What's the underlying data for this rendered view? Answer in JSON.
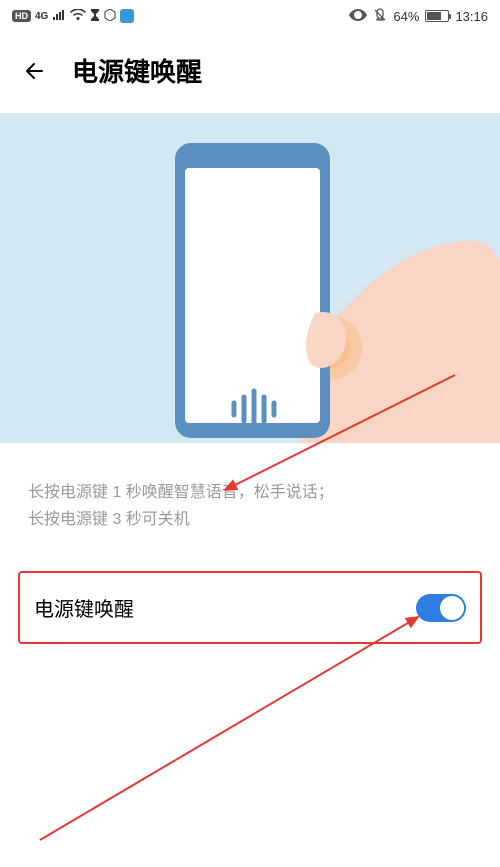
{
  "status": {
    "hd": "HD",
    "net": "4G",
    "battery_text": "64%",
    "time": "13:16"
  },
  "header": {
    "title": "电源键唤醒"
  },
  "description": {
    "line1": "长按电源键 1 秒唤醒智慧语音，松手说话；",
    "line2": "长按电源键 3 秒可关机"
  },
  "setting": {
    "label": "电源键唤醒",
    "enabled": true
  }
}
